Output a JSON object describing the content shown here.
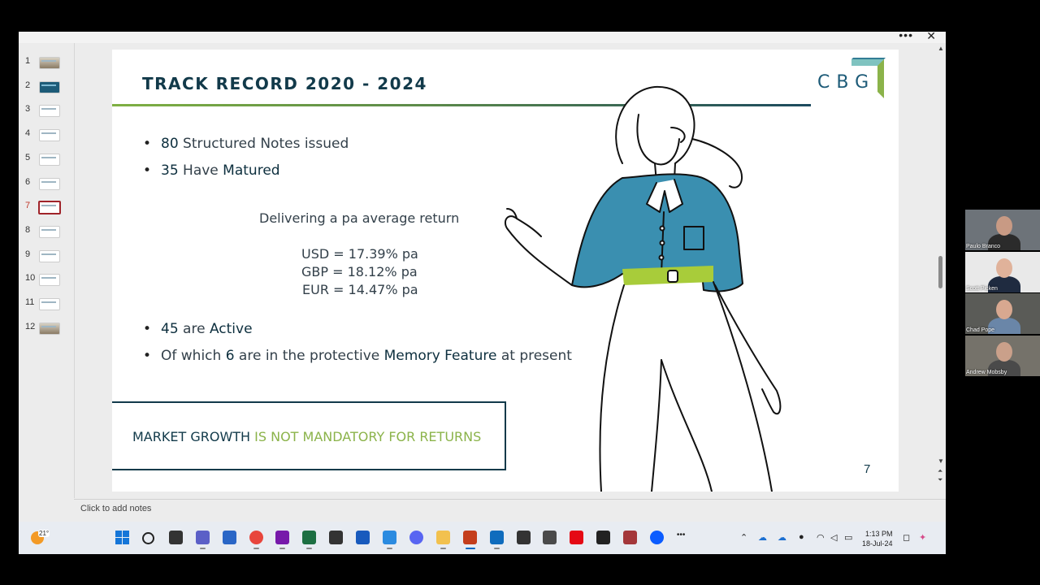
{
  "slide": {
    "title": "TRACK RECORD 2020 - 2024",
    "logo_text": "CBG",
    "bullets": [
      {
        "num": "80",
        "text": " Structured Notes issued"
      },
      {
        "num": "35",
        "pre": " Have ",
        "emph": "Matured"
      }
    ],
    "average_heading": "Delivering a pa average return",
    "returns": [
      "USD = 17.39% pa",
      "GBP = 18.12% pa",
      "EUR = 14.47% pa"
    ],
    "active": {
      "num": "45",
      "pre": " are ",
      "emph": "Active"
    },
    "memory": {
      "pre": "Of which ",
      "num": "6",
      "mid": " are in the protective ",
      "emph": "Memory Feature",
      "post": " at present"
    },
    "callout_a": "MARKET GROWTH",
    "callout_b": " IS NOT MANDATORY FOR RETURNS",
    "page_number": "7",
    "bullet_glyph": "•"
  },
  "thumbnails": [
    "1",
    "2",
    "3",
    "4",
    "5",
    "6",
    "7",
    "8",
    "9",
    "10",
    "11",
    "12"
  ],
  "active_thumbnail": "7",
  "notes_placeholder": "Click to add notes",
  "window": {
    "more": "•••",
    "close": "✕"
  },
  "taskbar": {
    "temperature": "21°",
    "time": "1:13 PM",
    "date": "18-Jul-24",
    "icons": [
      "start",
      "search",
      "task-view",
      "teams",
      "store",
      "chrome",
      "onenote",
      "excel",
      "app-k",
      "word",
      "snipping",
      "discord",
      "file-explorer",
      "powerpoint",
      "outlook",
      "sticky-notes",
      "calculator",
      "netflix",
      "app-dark",
      "access",
      "zoom",
      "more"
    ],
    "overflow": "•••"
  },
  "participants": [
    "Paulo Branco",
    "Scott Picken",
    "Chad Pope",
    "Andrew Mobsby"
  ],
  "colors": {
    "title": "#123a4a",
    "accent_green": "#8bb34a",
    "shirt": "#3a8fb0",
    "belt": "#a8cc3a"
  }
}
